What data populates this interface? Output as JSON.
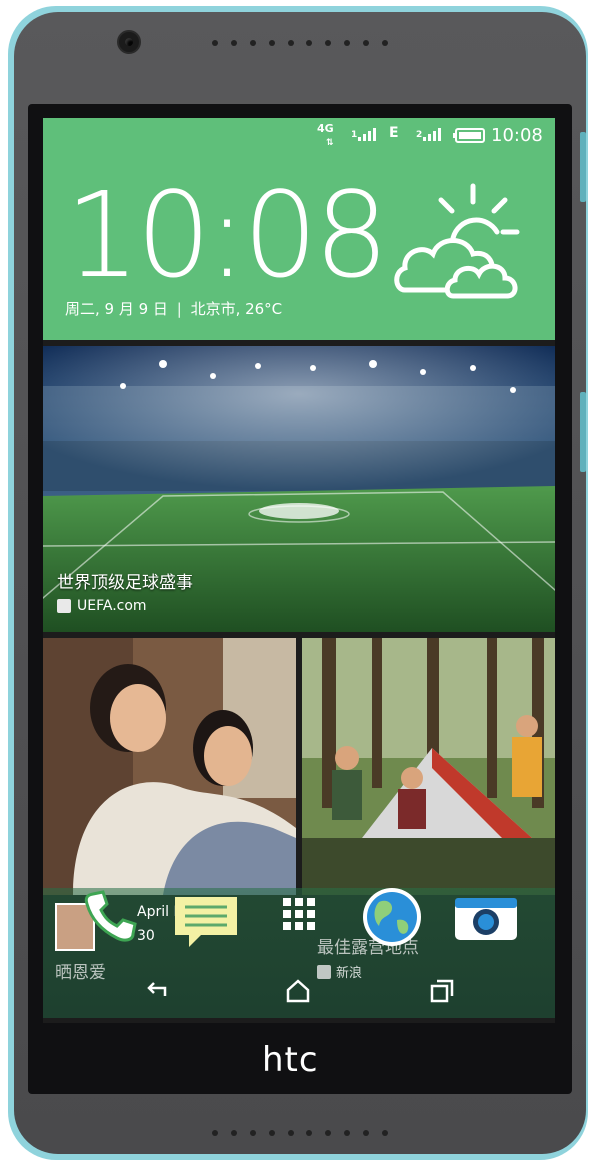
{
  "device": {
    "brand_logo": "htc",
    "colors": {
      "shell": "#8fd3dc",
      "body": "#4e4e50",
      "accent": "#5fbf7a"
    }
  },
  "status_bar": {
    "network": "4G",
    "signal1_label": "1",
    "data_type": "E",
    "signal2_label": "2",
    "time": "10:08"
  },
  "weather_widget": {
    "time": "10:08",
    "date": "周二, 9 月 9 日",
    "location_temp": "北京市, 26°C",
    "icon": "partly-cloudy-icon"
  },
  "feed": {
    "cards": [
      {
        "title": "世界顶级足球盛事",
        "source": "UEFA.com"
      },
      {
        "title": "晒恩爱",
        "source": "April L",
        "source_count": "30"
      },
      {
        "title": "最佳露营地点",
        "source": "新浪"
      }
    ]
  },
  "dock": {
    "items": [
      "phone-icon",
      "messages-icon",
      "app-drawer-icon",
      "browser-icon",
      "camera-icon"
    ]
  },
  "nav_bar": {
    "items": [
      "back-icon",
      "home-icon",
      "recents-icon"
    ]
  }
}
